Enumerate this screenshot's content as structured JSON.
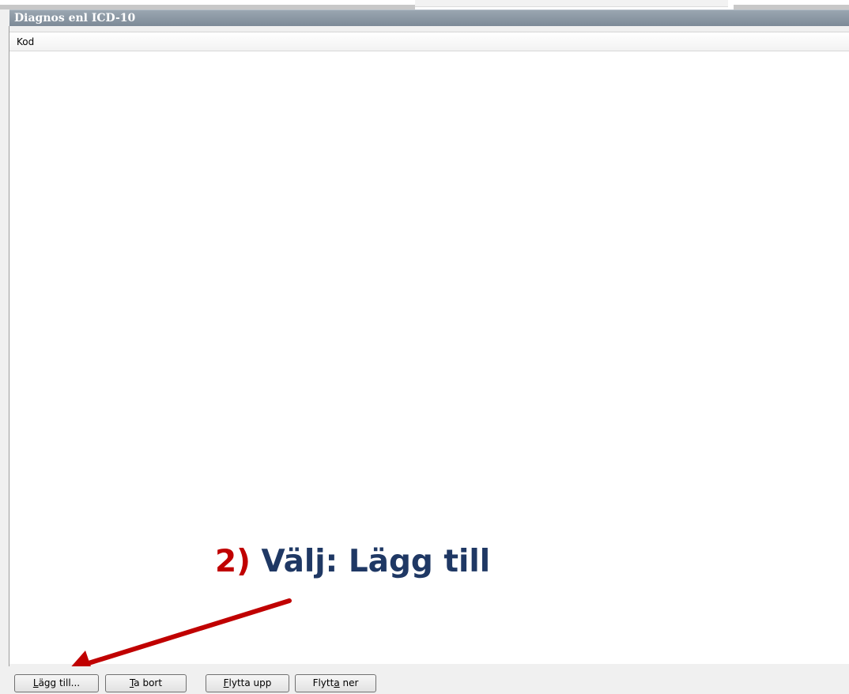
{
  "panel": {
    "title": "Diagnos enl ICD-10"
  },
  "list": {
    "columns": [
      "Kod"
    ]
  },
  "annotation": {
    "step": "2)",
    "text": "Välj: Lägg till",
    "step_color": "#c00000",
    "text_color": "#1f3864",
    "arrow_color": "#c00000"
  },
  "buttons": {
    "add": {
      "mnemonic": "L",
      "rest": "ägg till..."
    },
    "remove": {
      "mnemonic": "T",
      "rest": "a bort"
    },
    "move_up": {
      "mnemonic": "F",
      "rest": "lytta upp"
    },
    "move_down": {
      "before": "Flytt",
      "mnemonic": "a",
      "after": " ner"
    }
  }
}
